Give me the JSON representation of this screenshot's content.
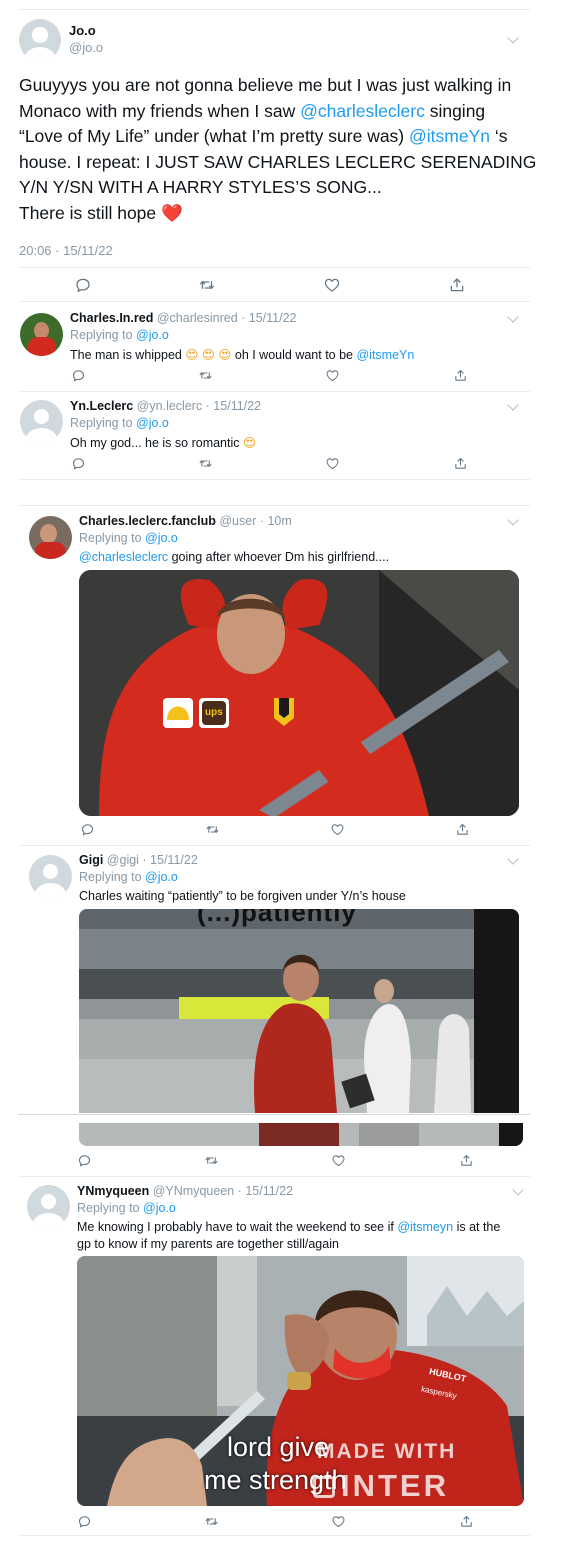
{
  "main_tweet": {
    "display_name": "Jo.o",
    "handle": "@jo.o",
    "text_lines": [
      [
        "Guuyyys you are not gonna believe me but I was just walking in"
      ],
      [
        "Monaco with my friends when I saw ",
        "@charlesleclerc",
        " singing"
      ],
      [
        "“Love of My Life” under (what I’m pretty sure was) ",
        "@itsmeYn",
        " ‘s"
      ],
      [
        "house. I repeat: I JUST SAW CHARLES LECLERC SERENADING"
      ],
      [
        "Y/N Y/SN WITH A HARRY STYLES’S SONG..."
      ],
      [
        "There is still hope ",
        "❤️"
      ]
    ],
    "line1": "Guuyyys you are not gonna believe me but I was just walking in",
    "line2_pre": "Monaco with my friends when I saw ",
    "line2_mention": "@charlesleclerc",
    "line2_post": " singing",
    "line3_pre": "“Love of My Life” under (what I’m pretty sure was) ",
    "line3_mention": "@itsmeYn",
    "line3_post": " ‘s",
    "line4": "house. I repeat: I JUST SAW CHARLES LECLERC SERENADING",
    "line5": "Y/N Y/SN WITH A HARRY STYLES’S SONG...",
    "line6_text": "There is still hope ",
    "line6_emoji": "❤️",
    "timestamp": "20:06 · 15/11/22"
  },
  "replies": [
    {
      "display_name": "Charles.In.red",
      "meta": "@charlesinred · 15/11/22",
      "replying_prefix": "Replying to ",
      "replying_handle": "@jo.o",
      "text_pre": "The man is whipped ",
      "emojis": "😍 😍 😍",
      "text_mid": " oh I would want to be ",
      "mention": "@itsmeYn"
    },
    {
      "display_name": "Yn.Leclerc",
      "meta": "@yn.leclerc · 15/11/22",
      "replying_prefix": "Replying to ",
      "replying_handle": "@jo.o",
      "text_pre": "Oh my god... he is so romantic ",
      "emojis": "😍"
    },
    {
      "display_name": "Charles.leclerc.fanclub",
      "meta": "@user · 10m",
      "replying_prefix": "Replying to ",
      "replying_handle": "@jo.o",
      "mention": "@charlesleclerc",
      "text_post": " going after whoever Dm his girlfriend....",
      "image": {
        "description_icon": "photo-meme-red-costume",
        "sponsor_1": "ups"
      }
    },
    {
      "display_name": "Gigi",
      "meta": "@gigi · 15/11/22",
      "replying_prefix": "Replying to ",
      "replying_handle": "@jo.o",
      "text": "Charles waiting “patiently” to be forgiven under Y/n’s house",
      "image": {
        "caption_top": "(...)patiently"
      }
    },
    {
      "display_name": "YNmyqueen",
      "meta": "@YNmyqueen · 15/11/22",
      "replying_prefix": "Replying to ",
      "replying_handle": "@jo.o",
      "text_pre": "Me knowing I probably have to wait the weekend to see if ",
      "mention": "@itsmeyn",
      "text_post": " is at the",
      "text_line2": "gp to know if my parents are together still/again",
      "image": {
        "caption_line1": "lord give",
        "caption_line2": "me strength",
        "watermark_line1": "MADE WITH",
        "watermark_line2": "INTER",
        "sponsor_1": "HUBLOT",
        "sponsor_2": "kaspersky"
      }
    }
  ],
  "actions": {
    "reply_icon": "reply-icon",
    "retweet_icon": "retweet-icon",
    "like_icon": "like-icon",
    "share_icon": "share-icon"
  },
  "colors": {
    "link_blue": "#1d9bf0",
    "meta_grey": "#8899a6",
    "divider": "#e6ecf0",
    "ferrari_red": "#d22a1e"
  }
}
